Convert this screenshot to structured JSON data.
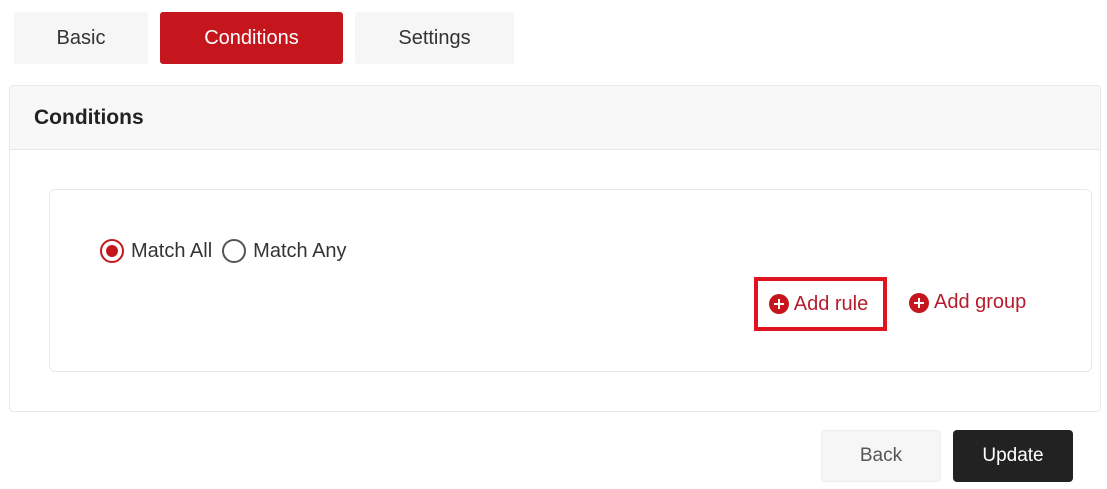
{
  "tabs": [
    {
      "label": "Basic",
      "active": false
    },
    {
      "label": "Conditions",
      "active": true
    },
    {
      "label": "Settings",
      "active": false
    }
  ],
  "panel": {
    "title": "Conditions",
    "match_options": [
      {
        "label": "Match All",
        "checked": true
      },
      {
        "label": "Match Any",
        "checked": false
      }
    ],
    "add_rule_label": "Add rule",
    "add_group_label": "Add group"
  },
  "footer": {
    "back_label": "Back",
    "update_label": "Update"
  },
  "colors": {
    "accent": "#c4161c",
    "link": "#b51c2c",
    "highlight_outline": "#e0141e",
    "primary_button": "#222222"
  },
  "icons": {
    "add_rule": "plus-circle-icon",
    "add_group": "plus-circle-icon"
  }
}
